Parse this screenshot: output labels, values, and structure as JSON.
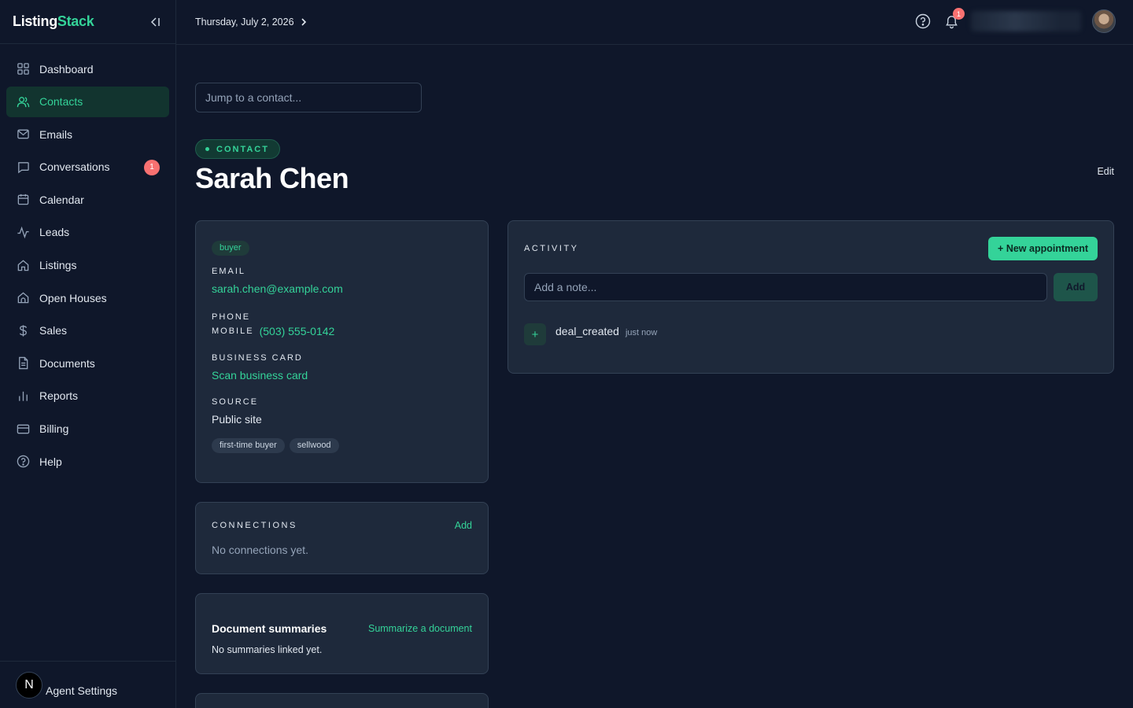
{
  "brand": {
    "name_part1": "Listing",
    "name_part2": "Stack"
  },
  "sidebar": {
    "items": [
      {
        "label": "Dashboard",
        "icon": "dashboard-icon"
      },
      {
        "label": "Contacts",
        "icon": "users-icon",
        "active": true
      },
      {
        "label": "Emails",
        "icon": "mail-icon"
      },
      {
        "label": "Conversations",
        "icon": "chat-icon",
        "badge": "1"
      },
      {
        "label": "Calendar",
        "icon": "calendar-icon"
      },
      {
        "label": "Leads",
        "icon": "activity-icon"
      },
      {
        "label": "Listings",
        "icon": "home-icon"
      },
      {
        "label": "Open Houses",
        "icon": "open-house-icon"
      },
      {
        "label": "Sales",
        "icon": "dollar-icon"
      },
      {
        "label": "Documents",
        "icon": "document-icon"
      },
      {
        "label": "Reports",
        "icon": "bar-chart-icon"
      },
      {
        "label": "Billing",
        "icon": "credit-card-icon"
      },
      {
        "label": "Help",
        "icon": "help-circle-icon"
      }
    ],
    "footer": {
      "avatar_letter": "N",
      "label": "Agent Settings"
    }
  },
  "topbar": {
    "date": "Thursday, July 2, 2026",
    "notification_count": "1"
  },
  "main": {
    "jump_placeholder": "Jump to a contact...",
    "pill": "CONTACT",
    "title": "Sarah Chen",
    "edit_label": "Edit"
  },
  "details": {
    "type_tag": "buyer",
    "email_label": "EMAIL",
    "email": "sarah.chen@example.com",
    "phone_label": "PHONE",
    "phone_kind": "MOBILE",
    "phone": "(503) 555-0142",
    "card_label": "BUSINESS CARD",
    "card_action": "Scan business card",
    "source_label": "SOURCE",
    "source": "Public site",
    "tags": [
      "first-time buyer",
      "sellwood"
    ]
  },
  "connections": {
    "label": "CONNECTIONS",
    "add": "Add",
    "empty": "No connections yet."
  },
  "documents": {
    "title": "Document summaries",
    "action": "Summarize a document",
    "empty": "No summaries linked yet."
  },
  "activity": {
    "label": "ACTIVITY",
    "new_appointment": "+ New appointment",
    "note_placeholder": "Add a note...",
    "add_label": "Add",
    "items": [
      {
        "text": "deal_created",
        "time": "just now"
      }
    ]
  },
  "colors": {
    "accent": "#34d399",
    "background": "#0f172a",
    "card": "#1e293b",
    "badge": "#f87171"
  }
}
